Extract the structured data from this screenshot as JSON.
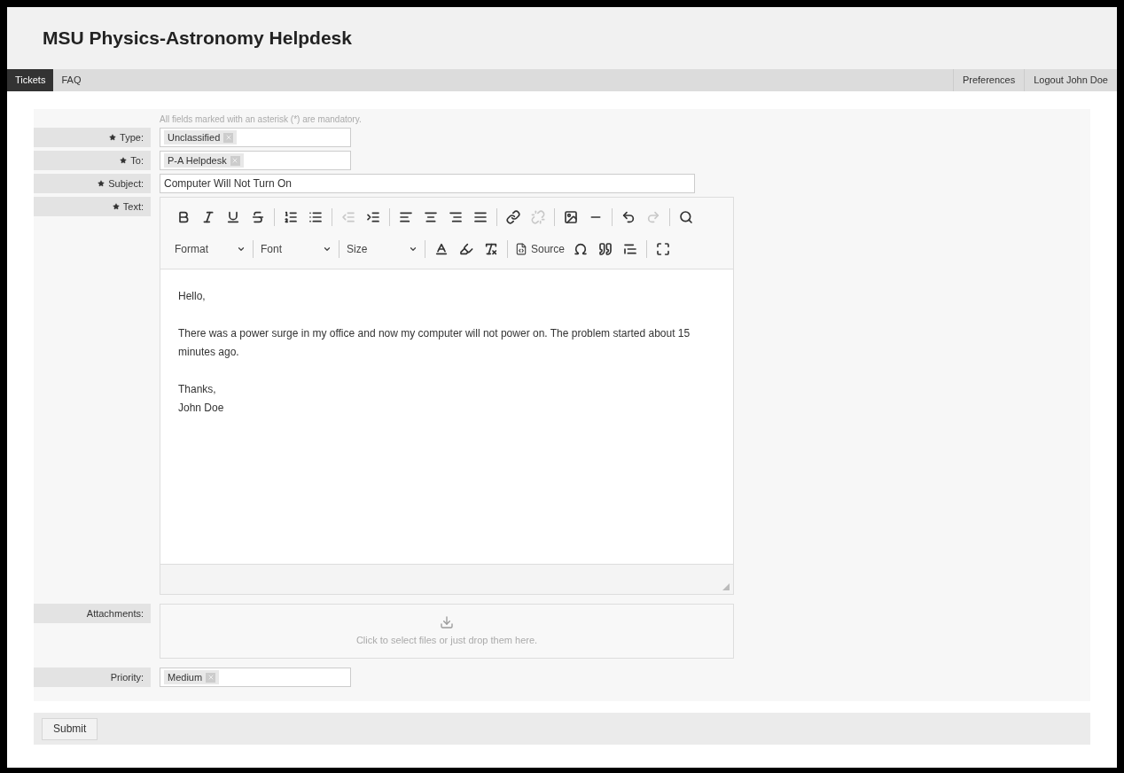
{
  "header": {
    "title": "MSU Physics-Astronomy Helpdesk"
  },
  "nav": {
    "left": [
      {
        "label": "Tickets",
        "selected": true
      },
      {
        "label": "FAQ",
        "selected": false
      }
    ],
    "right": [
      {
        "label": "Preferences"
      },
      {
        "label": "Logout John Doe"
      }
    ]
  },
  "form": {
    "note": "All fields marked with an asterisk (*) are mandatory.",
    "fields": [
      {
        "kind": "tags",
        "label": "Type:",
        "required": true,
        "tags": [
          "Unclassified"
        ]
      },
      {
        "kind": "tags",
        "label": "To:",
        "required": true,
        "tags": [
          "P-A Helpdesk"
        ]
      },
      {
        "kind": "text",
        "label": "Subject:",
        "required": true,
        "value": "Computer Will Not Turn On"
      },
      {
        "kind": "editor",
        "label": "Text:",
        "required": true,
        "dropdowns": [
          "Format",
          "Font",
          "Size"
        ],
        "source": "Source",
        "paragraphs": [
          [
            "Hello,"
          ],
          [
            "There was a power surge in my office and now my computer will not power on. The problem started about 15 minutes ago."
          ],
          [
            "Thanks,",
            "John Doe"
          ]
        ]
      },
      {
        "kind": "upload",
        "label": "Attachments:",
        "required": false,
        "hint": "Click to select files or just drop them here."
      },
      {
        "kind": "tags",
        "label": "Priority:",
        "required": false,
        "tags": [
          "Medium"
        ]
      }
    ]
  },
  "submit": {
    "label": "Submit"
  }
}
